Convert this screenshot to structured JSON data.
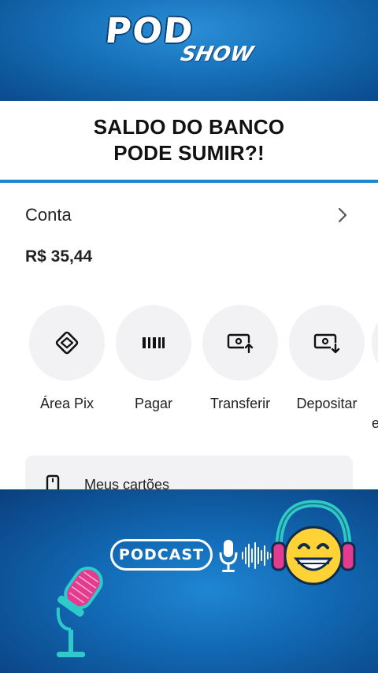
{
  "top_banner": {
    "logo_primary": "POD",
    "logo_secondary": "SHOW"
  },
  "headline": {
    "line1": "SALDO DO BANCO",
    "line2": "PODE SUMIR?!"
  },
  "account": {
    "title": "Conta",
    "balance": "R$ 35,44"
  },
  "actions": [
    {
      "label": "Área Pix",
      "icon": "pix-icon"
    },
    {
      "label": "Pagar",
      "icon": "barcode-icon"
    },
    {
      "label": "Transferir",
      "icon": "transfer-icon"
    },
    {
      "label": "Depositar",
      "icon": "deposit-icon"
    },
    {
      "label": "e",
      "icon": "more-action-icon"
    }
  ],
  "cards": {
    "label": "Meus cartões",
    "icon": "card-icon"
  },
  "bottom_banner": {
    "badge": "PODCAST"
  },
  "colors": {
    "banner_blue": "#1670b8",
    "accent_blue": "#1c86d1",
    "action_bg": "#f2f2f4",
    "text": "#222222"
  }
}
